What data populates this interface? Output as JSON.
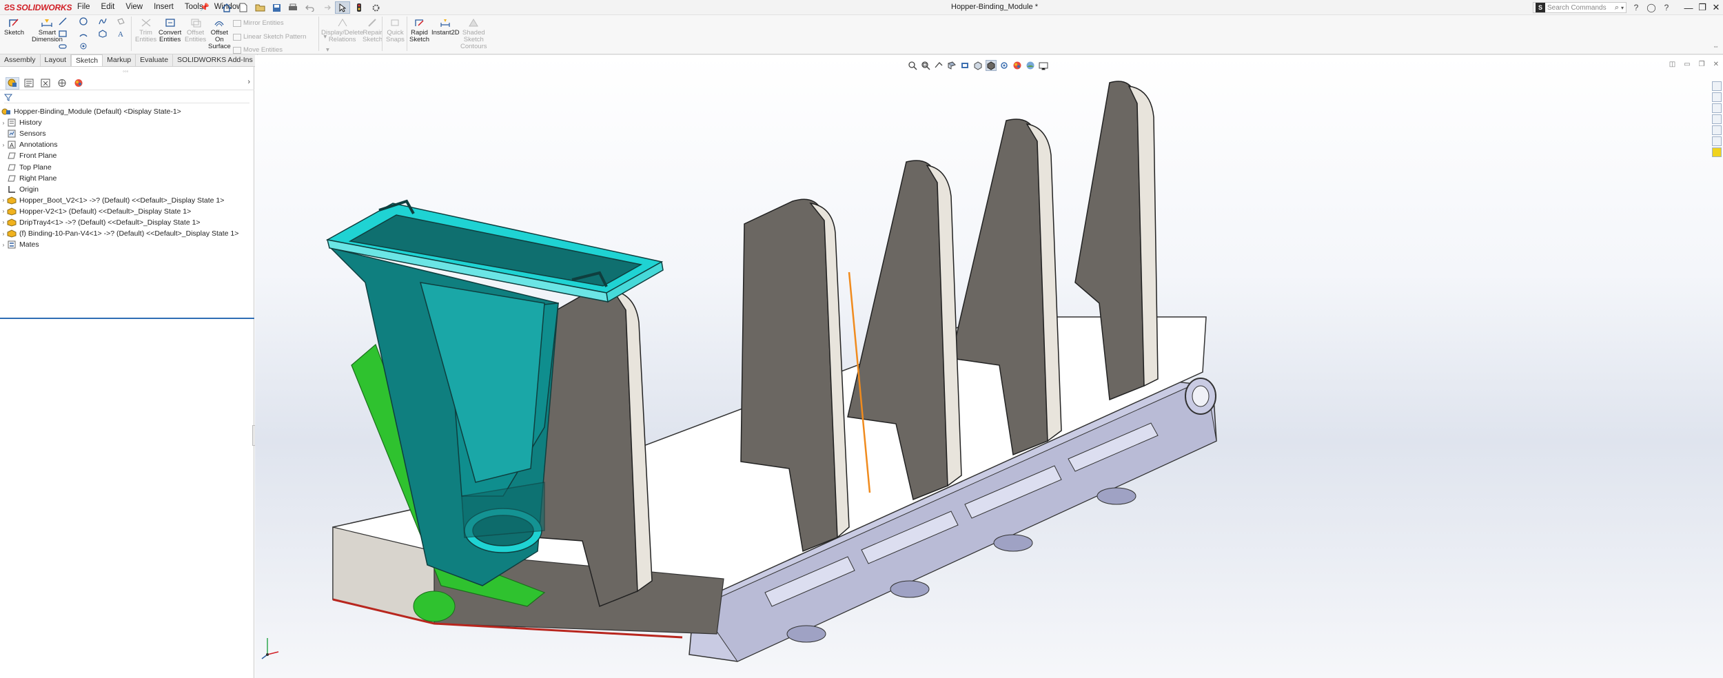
{
  "app": {
    "brand": "SOLIDWORKS",
    "document_title": "Hopper-Binding_Module *"
  },
  "menu": {
    "items": [
      "File",
      "Edit",
      "View",
      "Insert",
      "Tools",
      "Window"
    ]
  },
  "search": {
    "placeholder": "Search Commands"
  },
  "ribbon": {
    "sketch": "Sketch",
    "smart_dimension_1": "Smart",
    "smart_dimension_2": "Dimension",
    "trim_1": "Trim",
    "trim_2": "Entities",
    "convert_1": "Convert",
    "convert_2": "Entities",
    "offset_1": "Offset",
    "offset_2": "Entities",
    "offset_surface_1": "Offset",
    "offset_surface_2": "On",
    "offset_surface_3": "Surface",
    "mirror_entities": "Mirror Entities",
    "linear_pattern": "Linear Sketch Pattern",
    "move_entities": "Move Entities",
    "display_delete_1": "Display/Delete",
    "display_delete_2": "Relations",
    "repair_1": "Repair",
    "repair_2": "Sketch",
    "quick_snaps_1": "Quick",
    "quick_snaps_2": "Snaps",
    "rapid_1": "Rapid",
    "rapid_2": "Sketch",
    "instant2d": "Instant2D",
    "shaded_1": "Shaded",
    "shaded_2": "Sketch",
    "shaded_3": "Contours"
  },
  "tabs": [
    "Assembly",
    "Layout",
    "Sketch",
    "Markup",
    "Evaluate",
    "SOLIDWORKS Add-Ins"
  ],
  "active_tab": "Sketch",
  "tree": {
    "root": "Hopper-Binding_Module (Default) <Display State-1>",
    "items": [
      {
        "label": "History",
        "icon": "history-icon",
        "expandable": true
      },
      {
        "label": "Sensors",
        "icon": "sensors-icon",
        "expandable": false
      },
      {
        "label": "Annotations",
        "icon": "annotations-icon",
        "expandable": true
      },
      {
        "label": "Front Plane",
        "icon": "plane-icon",
        "expandable": false
      },
      {
        "label": "Top Plane",
        "icon": "plane-icon",
        "expandable": false
      },
      {
        "label": "Right Plane",
        "icon": "plane-icon",
        "expandable": false
      },
      {
        "label": "Origin",
        "icon": "origin-icon",
        "expandable": false
      },
      {
        "label": "Hopper_Boot_V2<1> ->? (Default) <<Default>_Display State 1>",
        "icon": "part-icon",
        "expandable": true
      },
      {
        "label": "Hopper-V2<1> (Default) <<Default>_Display State 1>",
        "icon": "part-icon",
        "expandable": true
      },
      {
        "label": "DripTray4<1> ->? (Default) <<Default>_Display State 1>",
        "icon": "part-icon",
        "expandable": true
      },
      {
        "label": "(f) Binding-10-Pan-V4<1> ->? (Default) <<Default>_Display State 1>",
        "icon": "part-icon",
        "expandable": true
      },
      {
        "label": "Mates",
        "icon": "mates-icon",
        "expandable": true
      }
    ]
  },
  "colors": {
    "accent_red": "#d11f26",
    "hopper_cyan": "#1fd3d3",
    "bracket_gray": "#6b6762",
    "tray_lavender": "#c9cbe3",
    "boot_green": "#2fc22f",
    "selection_blue": "#2e6db4"
  }
}
